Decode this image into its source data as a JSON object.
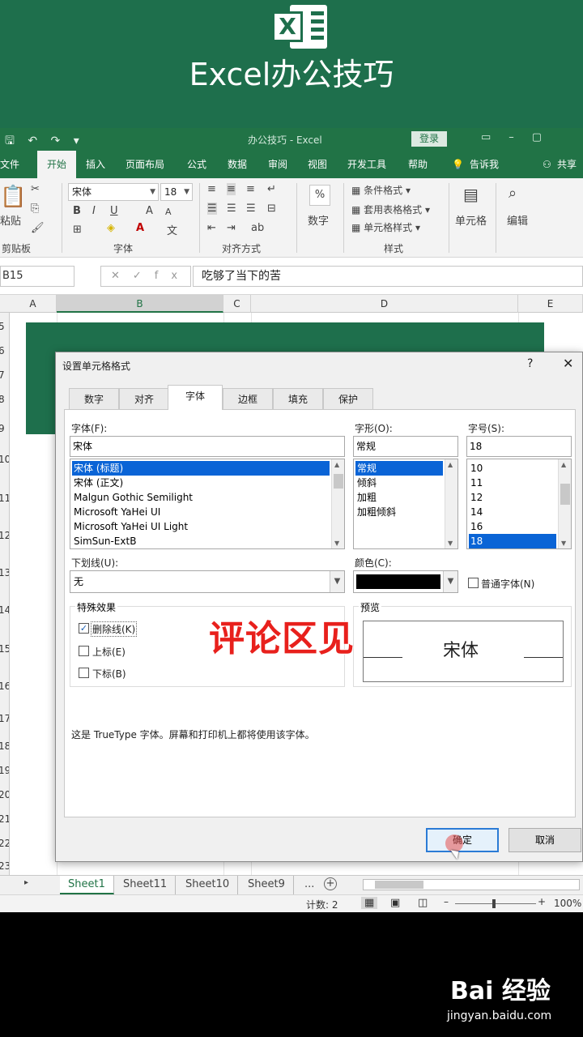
{
  "banner": {
    "title": "Excel办公技巧",
    "logo_letter": "X"
  },
  "titlebar": {
    "doc_title": "办公技巧 - Excel",
    "login": "登录"
  },
  "tabs": [
    "文件",
    "开始",
    "插入",
    "页面布局",
    "公式",
    "数据",
    "审阅",
    "视图",
    "开发工具",
    "帮助",
    "告诉我",
    "共享"
  ],
  "ribbon": {
    "paste": "粘贴",
    "clipboard": "剪贴板",
    "font_name": "宋体",
    "font_size": "18",
    "font_group": "字体",
    "align_group": "对齐方式",
    "number": "数字",
    "number_icon": "%",
    "styles": [
      "条件格式",
      "套用表格格式",
      "单元格样式"
    ],
    "styles_group": "样式",
    "cells": "单元格",
    "edit": "编辑",
    "bold": "B",
    "italic": "I",
    "underline": "U",
    "grow": "A",
    "shrink": "A"
  },
  "formula_bar": {
    "name_box": "B15",
    "content": "吃够了当下的苦"
  },
  "grid": {
    "columns": [
      "A",
      "B",
      "C",
      "D",
      "E"
    ],
    "rows": [
      "5",
      "6",
      "7",
      "8",
      "9",
      "10",
      "11",
      "12",
      "13",
      "14",
      "15",
      "16",
      "17",
      "18",
      "19",
      "20",
      "21",
      "22",
      "23"
    ]
  },
  "dialog": {
    "title": "设置单元格格式",
    "help": "?",
    "close": "✕",
    "tabs": [
      "数字",
      "对齐",
      "字体",
      "边框",
      "填充",
      "保护"
    ],
    "font_label": "字体(F):",
    "font_value": "宋体",
    "font_list": [
      "宋体 (标题)",
      "宋体 (正文)",
      "Malgun Gothic Semilight",
      "Microsoft YaHei UI",
      "Microsoft YaHei UI Light",
      "SimSun-ExtB"
    ],
    "style_label": "字形(O):",
    "style_value": "常规",
    "style_list": [
      "常规",
      "倾斜",
      "加粗",
      "加粗倾斜"
    ],
    "size_label": "字号(S):",
    "size_value": "18",
    "size_list": [
      "10",
      "11",
      "12",
      "14",
      "16",
      "18"
    ],
    "underline_label": "下划线(U):",
    "underline_value": "无",
    "color_label": "颜色(C):",
    "color_value": "#000000",
    "normal_font": "普通字体(N)",
    "effects_label": "特殊效果",
    "strikethrough": "删除线(K)",
    "superscript": "上标(E)",
    "subscript": "下标(B)",
    "preview_label": "预览",
    "preview_text": "宋体",
    "info": "这是 TrueType 字体。屏幕和打印机上都将使用该字体。",
    "ok": "确定",
    "cancel": "取消"
  },
  "overlay": "评论区见",
  "sheets": [
    "Sheet1",
    "Sheet11",
    "Sheet10",
    "Sheet9",
    "..."
  ],
  "status": {
    "count": "计数: 2",
    "zoom": "100%"
  },
  "watermark": {
    "logo": "Bai  经验",
    "url": "jingyan.baidu.com"
  },
  "colors": {
    "excel_green": "#217346",
    "banner_green": "#1e6f4c",
    "overlay_red": "#e8201c",
    "selection_blue": "#0a64d6"
  }
}
